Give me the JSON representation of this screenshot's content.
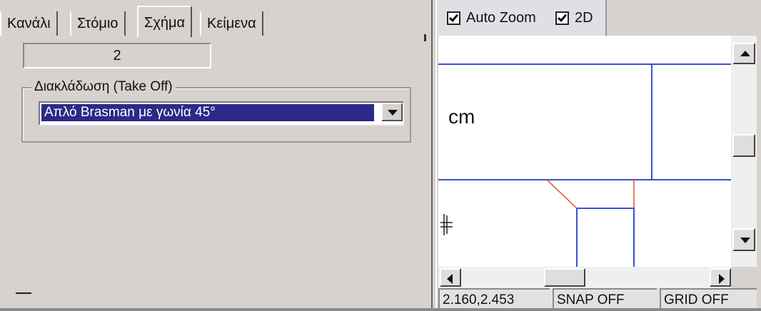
{
  "tabs": [
    {
      "label": "Κανάλι"
    },
    {
      "label": "Στόμιο"
    },
    {
      "label": "Σχήμα"
    },
    {
      "label": "Κείμενα"
    }
  ],
  "active_tab_index": 2,
  "shape": {
    "value": "2",
    "takeoff_group": {
      "label": "Διακλάδωση (Take Off)",
      "selected": "Απλό Brasman με γωνία 45°"
    }
  },
  "view_toolbar": {
    "auto_zoom": {
      "label": "Auto Zoom",
      "checked": true
    },
    "two_d": {
      "label": "2D",
      "checked": true
    }
  },
  "drawing": {
    "unit": "cm",
    "line_colors": {
      "blue": "#3a4fd6",
      "red": "#e0502a"
    }
  },
  "status_bar": {
    "coordinates": "2.160,2.453",
    "snap": "SNAP OFF",
    "grid": "GRID OFF"
  },
  "colors": {
    "selection": "#2b2a88",
    "panel": "#d6d2cf"
  }
}
